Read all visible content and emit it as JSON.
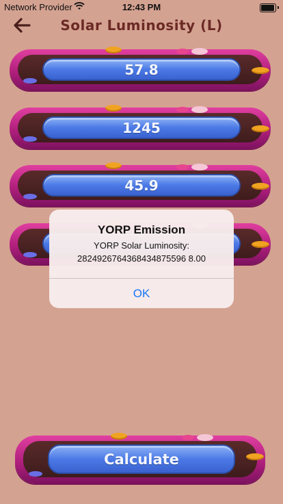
{
  "status_bar": {
    "carrier": "Network Provider",
    "time": "12:43 PM"
  },
  "nav": {
    "title": "Solar Luminosity (L)",
    "back_icon": "arrow-left-icon"
  },
  "fields": [
    {
      "value": "57.8"
    },
    {
      "value": "1245"
    },
    {
      "value": "45.9"
    },
    {
      "value": ""
    }
  ],
  "calculate_button": {
    "label": "Calculate"
  },
  "alert": {
    "title": "YORP Emission",
    "message_line1": "YORP Solar Luminosity:",
    "message_line2": "2824926764368434875596 8.00",
    "ok_label": "OK"
  },
  "colors": {
    "background": "#d4a291",
    "title": "#6b2a26",
    "pill_magenta": "#b01f7c",
    "field_blue": "#4b79e6",
    "ios_blue": "#1677f7"
  }
}
